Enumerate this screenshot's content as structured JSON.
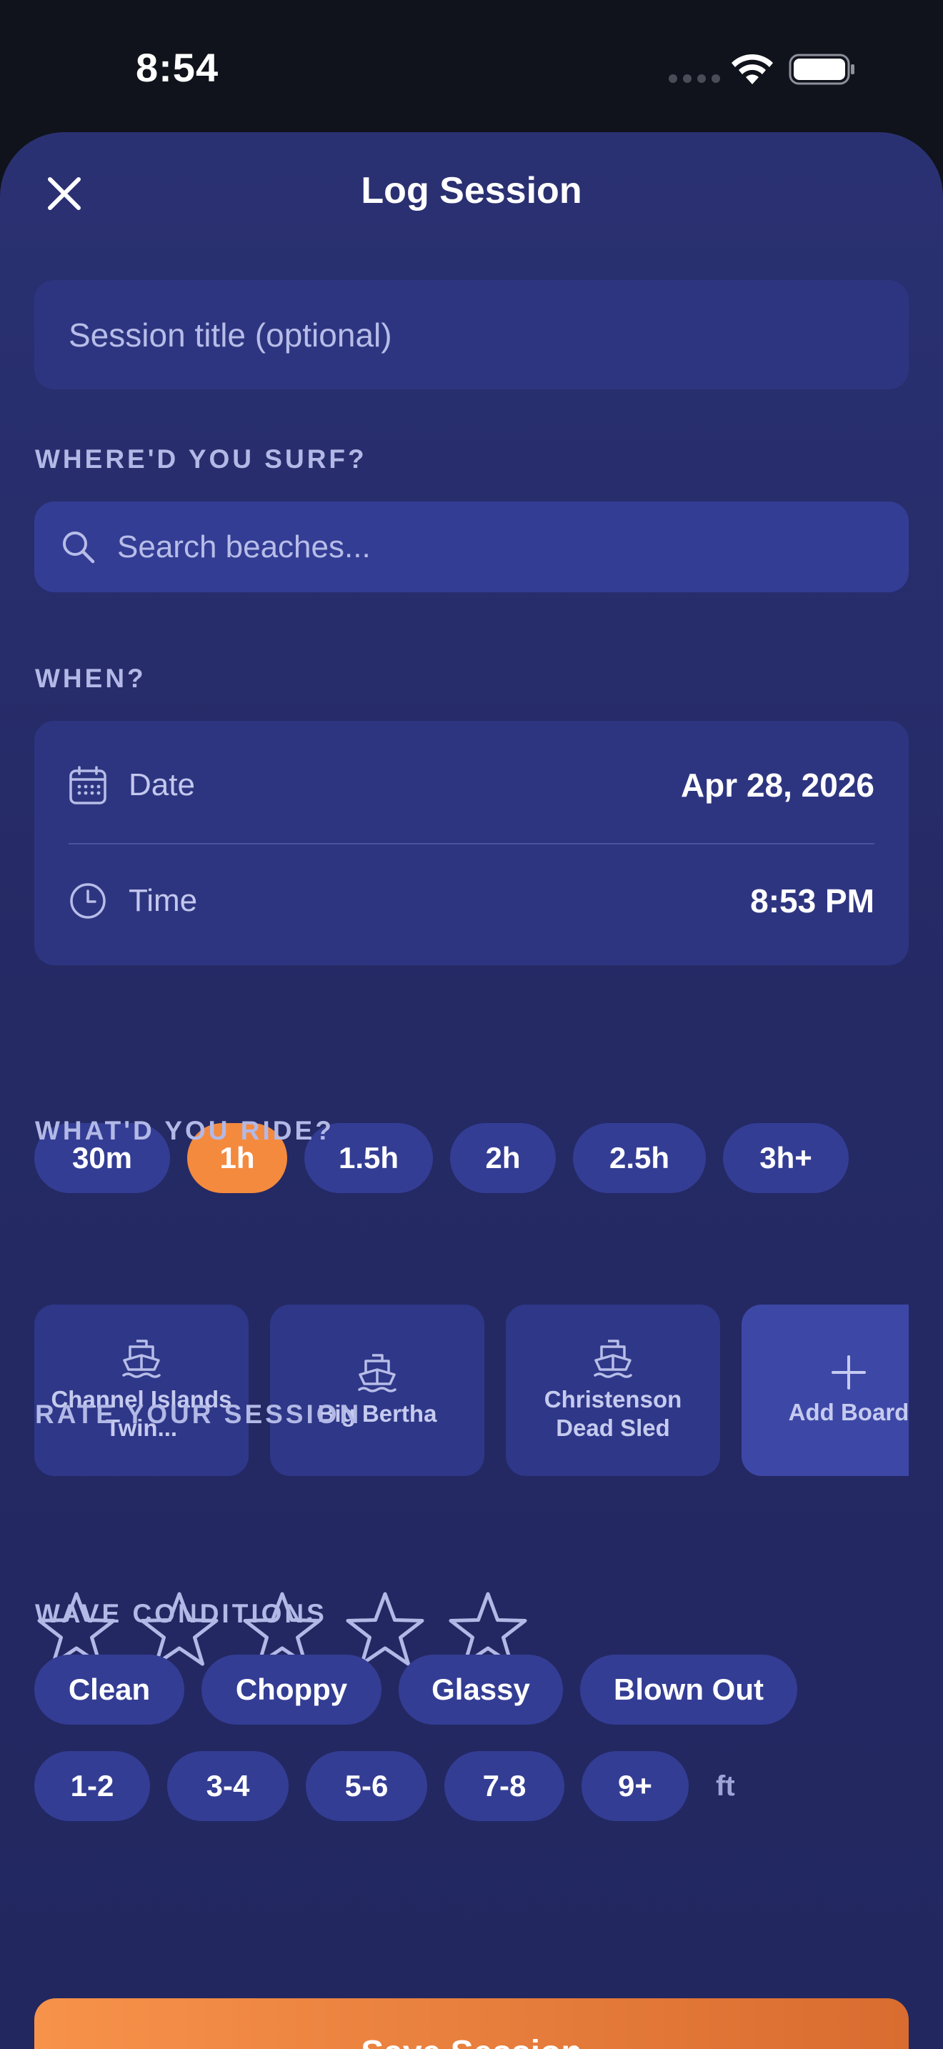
{
  "status_bar": {
    "time": "8:54"
  },
  "header": {
    "title": "Log Session"
  },
  "title_field": {
    "placeholder": "Session title (optional)"
  },
  "location": {
    "label": "WHERE'D YOU SURF?",
    "search_placeholder": "Search beaches..."
  },
  "when": {
    "label": "WHEN?",
    "date_label": "Date",
    "date_value": "Apr 28, 2026",
    "time_label": "Time",
    "time_value": "8:53 PM"
  },
  "durations": [
    {
      "label": "30m",
      "selected": false
    },
    {
      "label": "1h",
      "selected": true
    },
    {
      "label": "1.5h",
      "selected": false
    },
    {
      "label": "2h",
      "selected": false
    },
    {
      "label": "2.5h",
      "selected": false
    },
    {
      "label": "3h+",
      "selected": false
    }
  ],
  "boards": {
    "label": "WHAT'D YOU RIDE?",
    "items": [
      {
        "name": "Channel Islands Twin..."
      },
      {
        "name": "Big Bertha"
      },
      {
        "name": "Christenson Dead Sled"
      }
    ],
    "add_label": "Add Board"
  },
  "rating": {
    "label": "RATE YOUR SESSION",
    "value": 0,
    "max": 5
  },
  "conditions": {
    "label": "WAVE CONDITIONS",
    "types": [
      "Clean",
      "Choppy",
      "Glassy",
      "Blown Out"
    ],
    "sizes": [
      "1-2",
      "3-4",
      "5-6",
      "7-8",
      "9+"
    ],
    "size_unit": "ft"
  },
  "save_label": "Save Session",
  "colors": {
    "accent": "#f48a3e",
    "sheet": "#262c6a",
    "chip": "#343d94",
    "label": "#b3b9e6"
  }
}
